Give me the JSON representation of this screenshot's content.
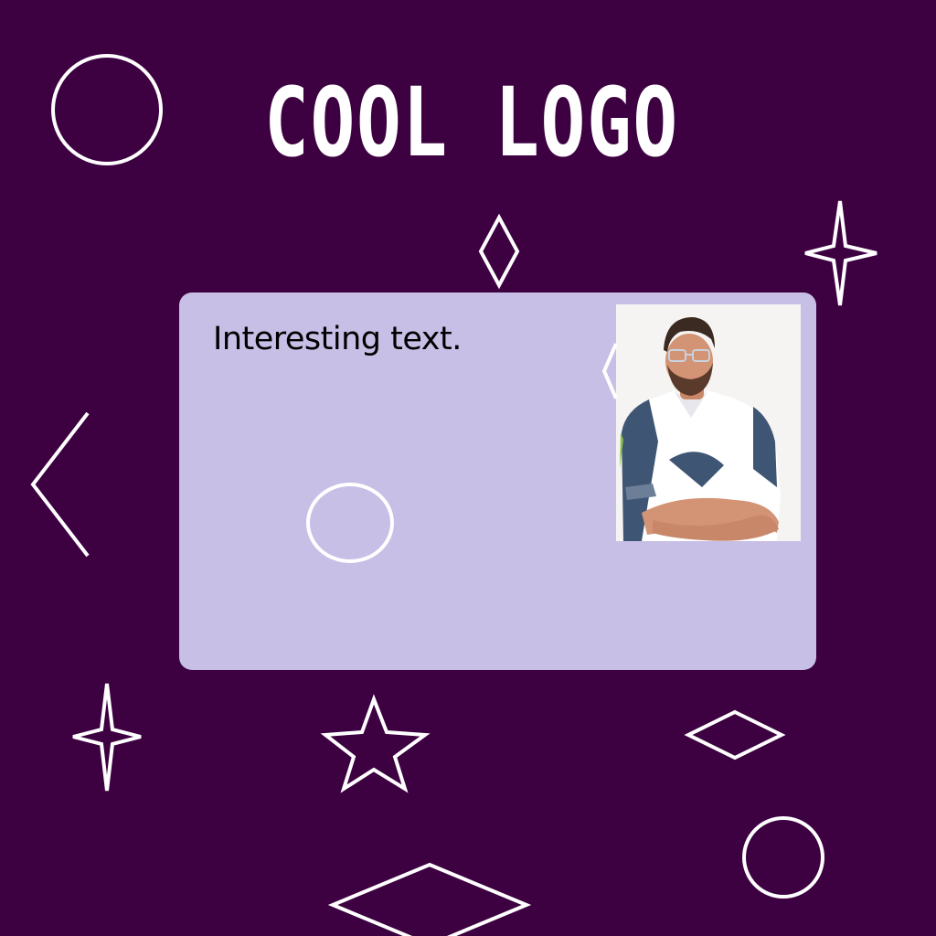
{
  "logo": {
    "text": "COOL LOGO"
  },
  "card": {
    "text": "Interesting text."
  },
  "photo": {
    "subject": "person-portrait"
  },
  "colors": {
    "background": "#3d0041",
    "card": "#c7bfe6",
    "outline": "#ffffff",
    "text_dark": "#000000"
  }
}
